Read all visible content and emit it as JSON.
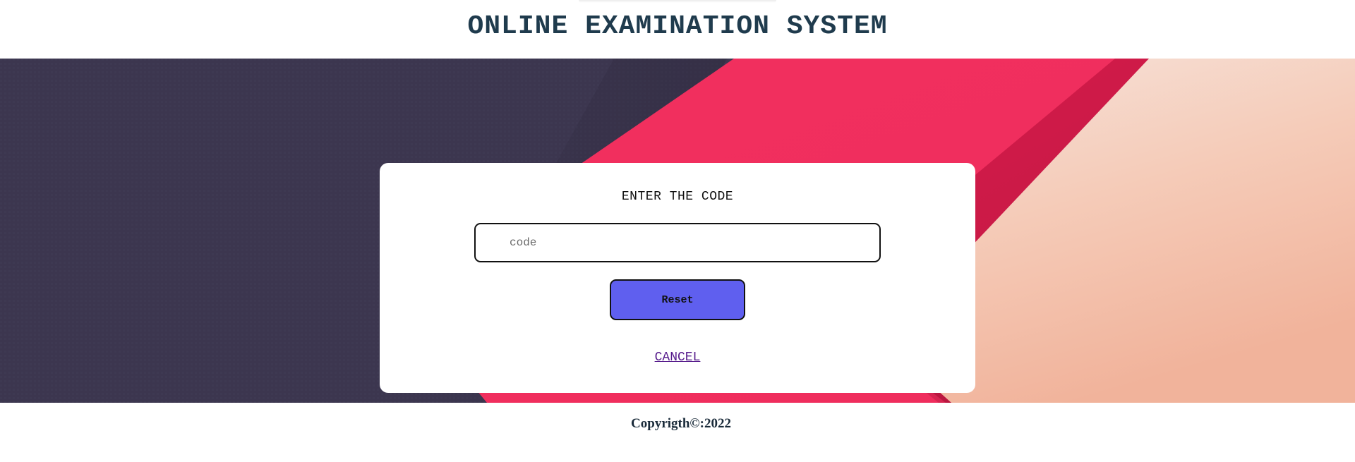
{
  "header": {
    "title": "ONLINE EXAMINATION SYSTEM"
  },
  "form": {
    "heading": "ENTER THE CODE",
    "code_placeholder": "code",
    "code_value": "",
    "reset_label": "Reset",
    "cancel_label": "CANCEL"
  },
  "footer": {
    "copyright": "Copyrigth©:2022"
  },
  "colors": {
    "title_text": "#1f3b4d",
    "button_bg": "#5f5fef",
    "hero_dark": "#3c364f",
    "hero_pink": "#f02d5e",
    "hero_peach": "#f4c3ae",
    "link": "#551a8b"
  }
}
